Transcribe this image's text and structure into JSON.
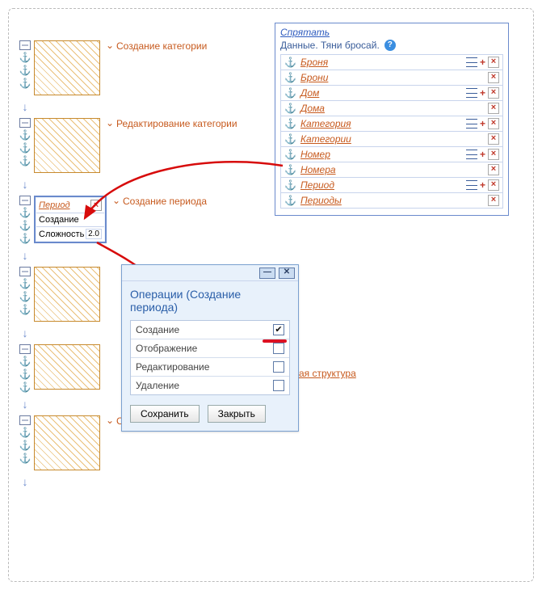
{
  "left": {
    "blocks": [
      {
        "label": "Создание категории",
        "expanded": false
      },
      {
        "label": "Редактирование категории",
        "expanded": false
      },
      {
        "label": "Создание периода",
        "expanded": true
      },
      {
        "label": "",
        "expanded": false
      },
      {
        "label": "",
        "expanded": false
      },
      {
        "label": "Создание дома",
        "expanded": false
      }
    ],
    "period": {
      "link": "Период",
      "op": "Создание",
      "diff_label": "Сложность",
      "diff_val": "2.0"
    }
  },
  "right": {
    "hide_label": "Спрятать",
    "subtitle": "Данные. Тяни бросай.",
    "items": [
      {
        "label": "Броня",
        "hasLines": true
      },
      {
        "label": "Брони",
        "hasLines": false
      },
      {
        "label": "Дом",
        "hasLines": true
      },
      {
        "label": "Дома",
        "hasLines": false
      },
      {
        "label": "Категория",
        "hasLines": true
      },
      {
        "label": "Категории",
        "hasLines": false
      },
      {
        "label": "Номер",
        "hasLines": true
      },
      {
        "label": "Номера",
        "hasLines": false
      },
      {
        "label": "Период",
        "hasLines": true
      },
      {
        "label": "Периоды",
        "hasLines": false
      }
    ]
  },
  "other_struct": "ая структура",
  "dialog": {
    "title": "Операции (Создание периода)",
    "rows": [
      {
        "label": "Создание",
        "checked": true
      },
      {
        "label": "Отображение",
        "checked": false
      },
      {
        "label": "Редактирование",
        "checked": false
      },
      {
        "label": "Удаление",
        "checked": false
      }
    ],
    "save": "Сохранить",
    "close": "Закрыть"
  }
}
